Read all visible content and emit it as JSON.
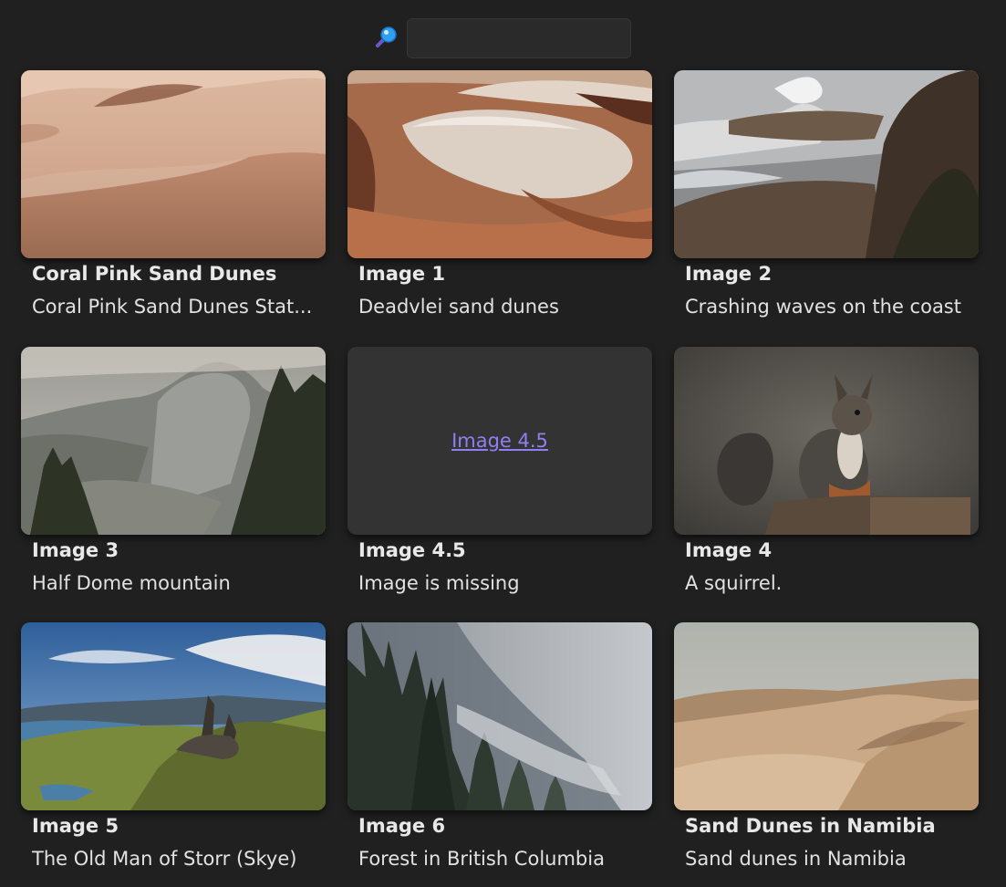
{
  "search": {
    "icon": "magnifier-icon",
    "value": "",
    "placeholder": ""
  },
  "gallery": [
    {
      "title": "Coral Pink Sand Dunes",
      "description": "Coral Pink Sand Dunes Stat...",
      "image": "pink-sand-dunes"
    },
    {
      "title": "Image 1",
      "description": "Deadvlei sand dunes",
      "image": "deadvlei-dunes"
    },
    {
      "title": "Image 2",
      "description": "Crashing waves on the coast",
      "image": "coast-waves"
    },
    {
      "title": "Image 3",
      "description": "Half Dome mountain",
      "image": "half-dome"
    },
    {
      "title": "Image 4.5",
      "description": "Image is missing",
      "image": "missing",
      "missing_link_text": "Image 4.5"
    },
    {
      "title": "Image 4",
      "description": "A squirrel.",
      "image": "squirrel"
    },
    {
      "title": "Image 5",
      "description": "The Old Man of Storr (Skye)",
      "image": "old-man-of-storr"
    },
    {
      "title": "Image 6",
      "description": "Forest in British Columbia",
      "image": "misty-forest"
    },
    {
      "title": "Sand Dunes in Namibia",
      "description": "Sand dunes in Namibia",
      "image": "namibia-dunes"
    }
  ],
  "colors": {
    "background": "#202020",
    "input_background": "#2a2a2a",
    "missing_tile": "#333333",
    "link": "#8f7ff0"
  }
}
